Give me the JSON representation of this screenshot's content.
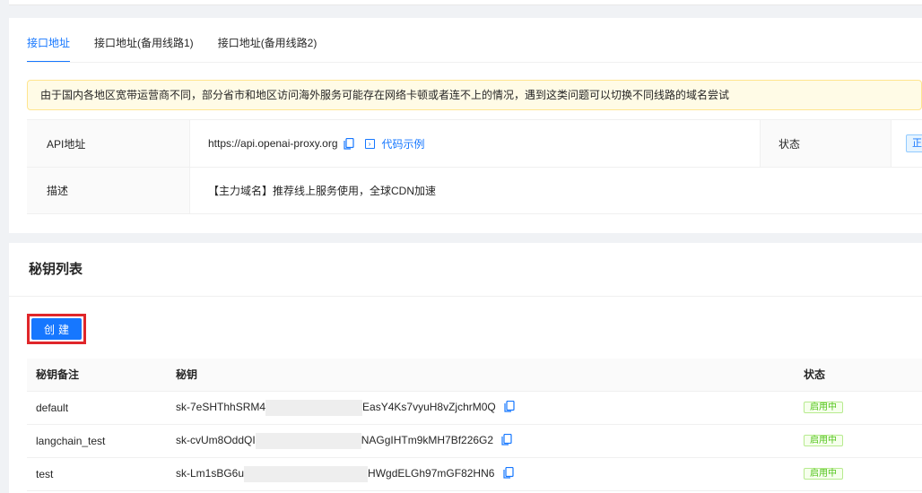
{
  "tabs": [
    "接口地址",
    "接口地址(备用线路1)",
    "接口地址(备用线路2)"
  ],
  "notice": "由于国内各地区宽带运营商不同，部分省市和地区访问海外服务可能存在网络卡顿或者连不上的情况，遇到这类问题可以切换不同线路的域名尝试",
  "info": {
    "api_label": "API地址",
    "api_url": "https://api.openai-proxy.org",
    "code_example": "代码示例",
    "status_label": "状态",
    "status_value": "正",
    "desc_label": "描述",
    "desc_value": "【主力域名】推荐线上服务使用，全球CDN加速"
  },
  "keys": {
    "title": "秘钥列表",
    "create_label": "创建",
    "columns": [
      "秘钥备注",
      "秘钥",
      "状态"
    ],
    "rows": [
      {
        "note": "default",
        "key_start": "sk-7eSHThhSRM4",
        "key_end": "EasY4Ks7vyuH8vZjchrM0Q",
        "status": "启用中"
      },
      {
        "note": "langchain_test",
        "key_start": "sk-cvUm8OddQI",
        "key_end": "NAGgIHTm9kMH7Bf226G2",
        "status": "启用中"
      },
      {
        "note": "test",
        "key_start": "sk-Lm1sBG6u",
        "key_end": "HWgdELGh97mGF82HN6",
        "status": "启用中"
      }
    ]
  },
  "colors": {
    "accent": "#1677ff",
    "success": "#52c41a",
    "highlight": "#e0262a"
  }
}
